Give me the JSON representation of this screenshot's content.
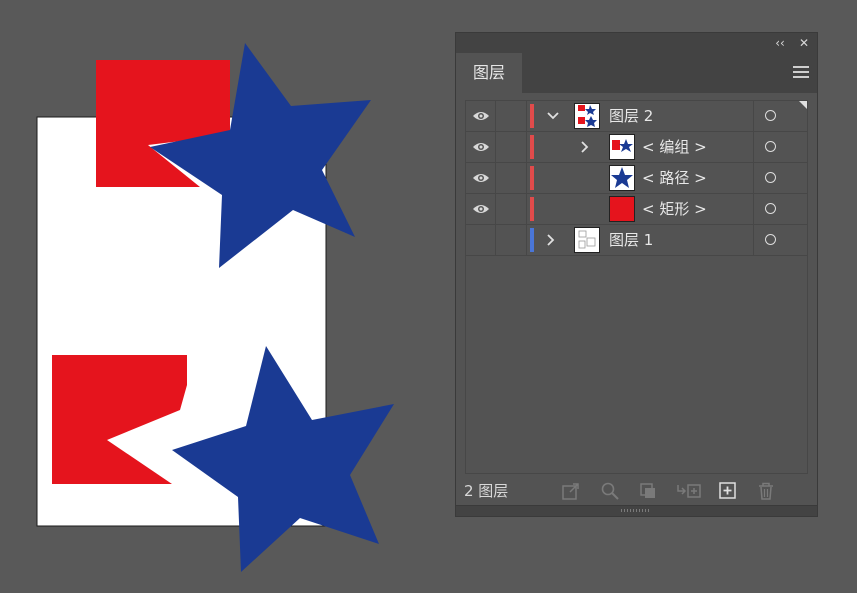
{
  "panel": {
    "collapse_label": "‹‹",
    "close_label": "✕",
    "tab_label": "图层",
    "menu_icon": "hamburger-menu-icon",
    "layers": [
      {
        "name": "图层 2",
        "color": "#e04b4b",
        "visible": true,
        "expanded": true,
        "level": 0
      },
      {
        "name": "< 编组 >",
        "color": "#e04b4b",
        "visible": true,
        "expanded": false,
        "level": 1
      },
      {
        "name": "< 路径 >",
        "color": "#e04b4b",
        "visible": true,
        "level": 1
      },
      {
        "name": "< 矩形 >",
        "color": "#e04b4b",
        "visible": true,
        "level": 1
      },
      {
        "name": "图层 1",
        "color": "#4a76d8",
        "visible": false,
        "expanded": false,
        "level": 0
      }
    ],
    "footer": {
      "count_label": "2 图层",
      "icons": [
        "export-icon",
        "locate-object-icon",
        "make-clipping-mask-icon",
        "create-sublayer-icon",
        "new-layer-icon",
        "delete-icon"
      ]
    }
  },
  "artwork": {
    "red": "#e5141d",
    "blue": "#1a3a93",
    "artboard": "#ffffff"
  }
}
